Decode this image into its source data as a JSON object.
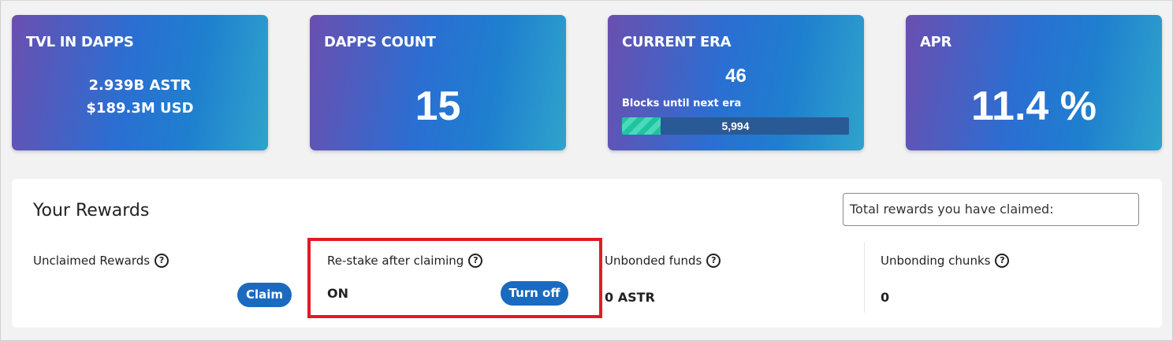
{
  "stats": {
    "tvl": {
      "title": "TVL IN DAPPS",
      "astr": "2.939B ASTR",
      "usd": "$189.3M USD"
    },
    "dapps": {
      "title": "DAPPS COUNT",
      "value": "15"
    },
    "era": {
      "title": "CURRENT ERA",
      "value": "46",
      "sub": "Blocks until next era",
      "blocks": "5,994",
      "progress": 0.17
    },
    "apr": {
      "title": "APR",
      "value": "11.4 %"
    }
  },
  "rewards": {
    "title": "Your Rewards",
    "total_label": "Total rewards you have claimed:",
    "unclaimed": {
      "label": "Unclaimed Rewards",
      "button": "Claim"
    },
    "restake": {
      "label": "Re-stake after claiming",
      "value": "ON",
      "button": "Turn off"
    },
    "unbonded": {
      "label": "Unbonded funds",
      "value": "0 ASTR"
    },
    "unbonding": {
      "label": "Unbonding chunks",
      "value": "0"
    }
  },
  "colors": {
    "button": "#1a6ac0",
    "highlight": "#e01b24"
  },
  "icons": {
    "help": "question-circle-icon"
  }
}
